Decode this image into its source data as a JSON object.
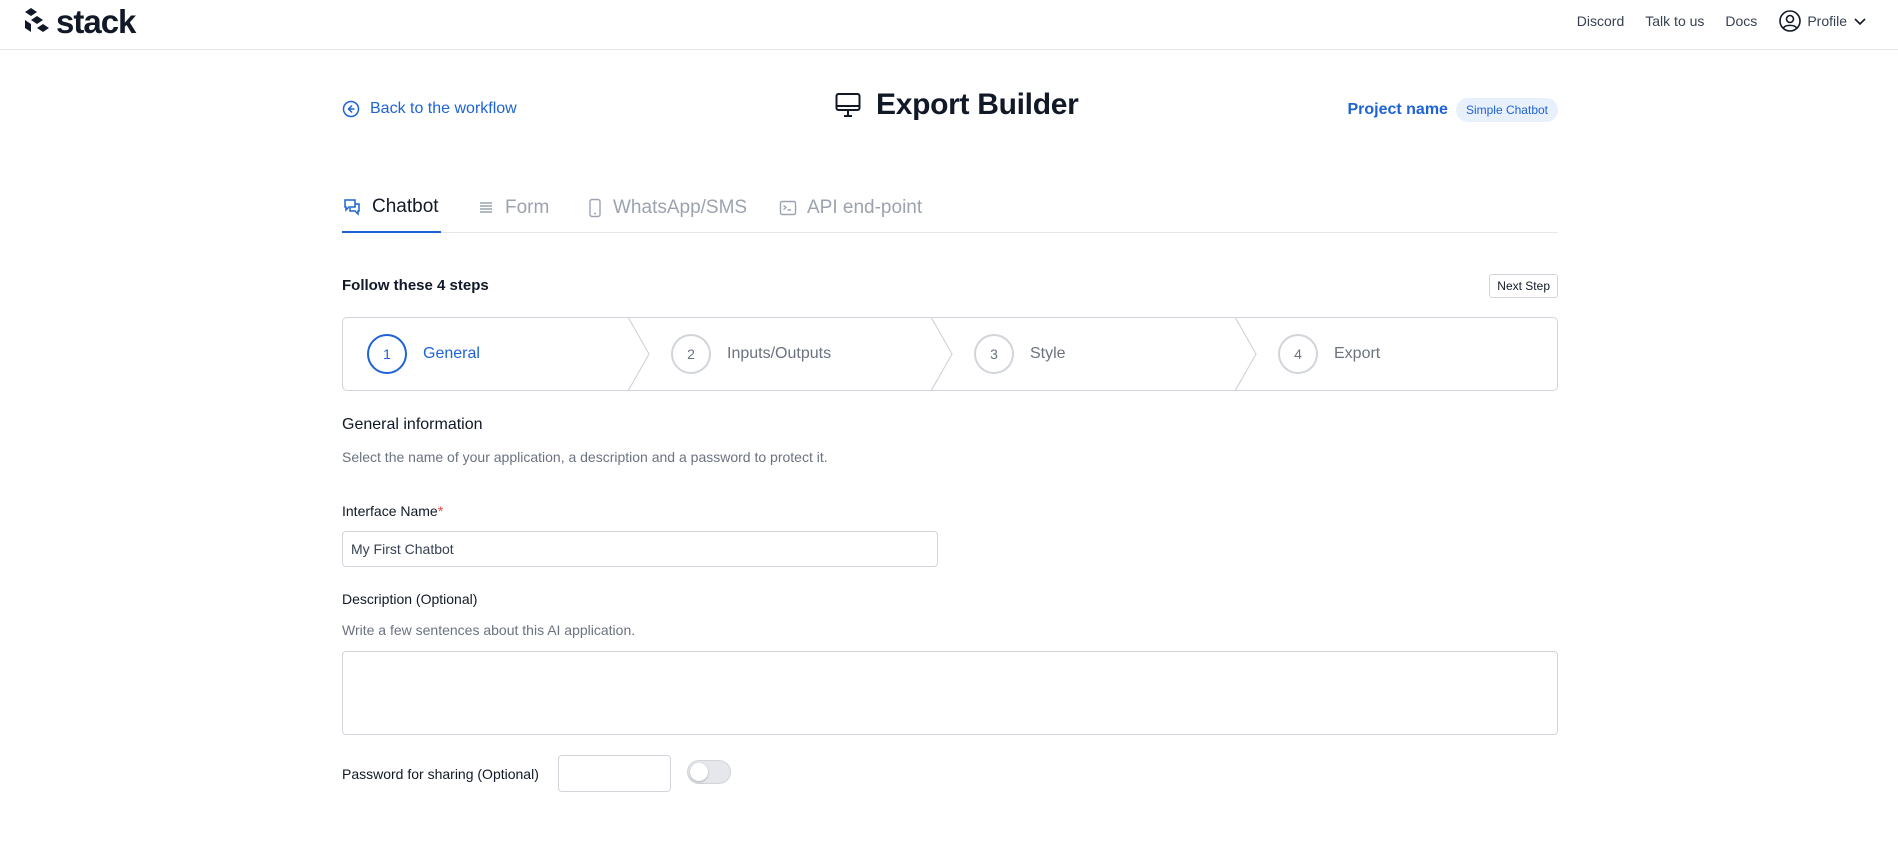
{
  "brand": {
    "name": "stack",
    "icon": "stack-logo-icon"
  },
  "topnav": {
    "links": [
      "Discord",
      "Talk to us",
      "Docs"
    ],
    "profile_label": "Profile",
    "profile_icon": "user-circle-icon"
  },
  "header": {
    "back_label": "Back to the workflow",
    "title": "Export Builder",
    "title_icon": "monitor-icon",
    "project_label": "Project name",
    "project_value": "Simple Chatbot"
  },
  "tabs": [
    {
      "label": "Chatbot",
      "icon": "chat-icon",
      "active": true
    },
    {
      "label": "Form",
      "icon": "list-icon",
      "active": false
    },
    {
      "label": "WhatsApp/SMS",
      "icon": "phone-icon",
      "active": false
    },
    {
      "label": "API end-point",
      "icon": "terminal-icon",
      "active": false
    }
  ],
  "steps": {
    "title": "Follow these 4 steps",
    "next_label": "Next Step",
    "items": [
      {
        "number": "1",
        "label": "General",
        "active": true
      },
      {
        "number": "2",
        "label": "Inputs/Outputs",
        "active": false
      },
      {
        "number": "3",
        "label": "Style",
        "active": false
      },
      {
        "number": "4",
        "label": "Export",
        "active": false
      }
    ]
  },
  "form": {
    "section_title": "General information",
    "section_desc": "Select the name of your application, a description and a password to protect it.",
    "name_label": "Interface Name",
    "name_required": "*",
    "name_value": "My First Chatbot",
    "desc_label": "Description (Optional)",
    "desc_hint": "Write a few sentences about this AI application.",
    "desc_value": "",
    "password_label": "Password for sharing (Optional)",
    "password_value": "",
    "password_toggle_on": false
  },
  "colors": {
    "accent": "#1d63d6",
    "border": "#d1d5db",
    "muted": "#6b7280"
  }
}
